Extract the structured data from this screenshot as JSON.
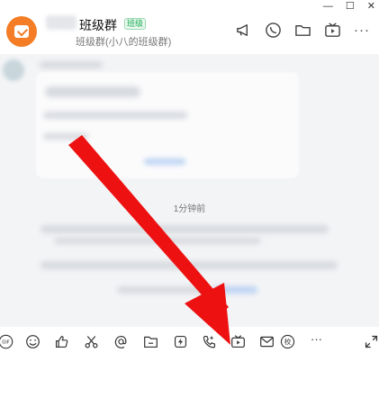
{
  "window": {
    "minimize": "—",
    "maximize": "☐",
    "close": "✕"
  },
  "header": {
    "title": "班级群",
    "badge": "班级",
    "subtitle": "班级群(小八的班级群)",
    "icons": [
      "announcement-icon",
      "voice-call-icon",
      "folder-icon",
      "video-icon"
    ],
    "more": "···"
  },
  "chat": {
    "timestamp": "1分钟前"
  },
  "toolbar": {
    "gif_label": "GIF",
    "items": [
      "emoji-icon",
      "thumbs-up-icon",
      "scissors-icon",
      "mention-icon",
      "folder-icon",
      "lightning-icon",
      "phone-icon",
      "video-play-icon",
      "mail-icon",
      "school-icon"
    ],
    "school_label": "校",
    "more": "···"
  },
  "annotation": {
    "color": "#ee1111"
  }
}
